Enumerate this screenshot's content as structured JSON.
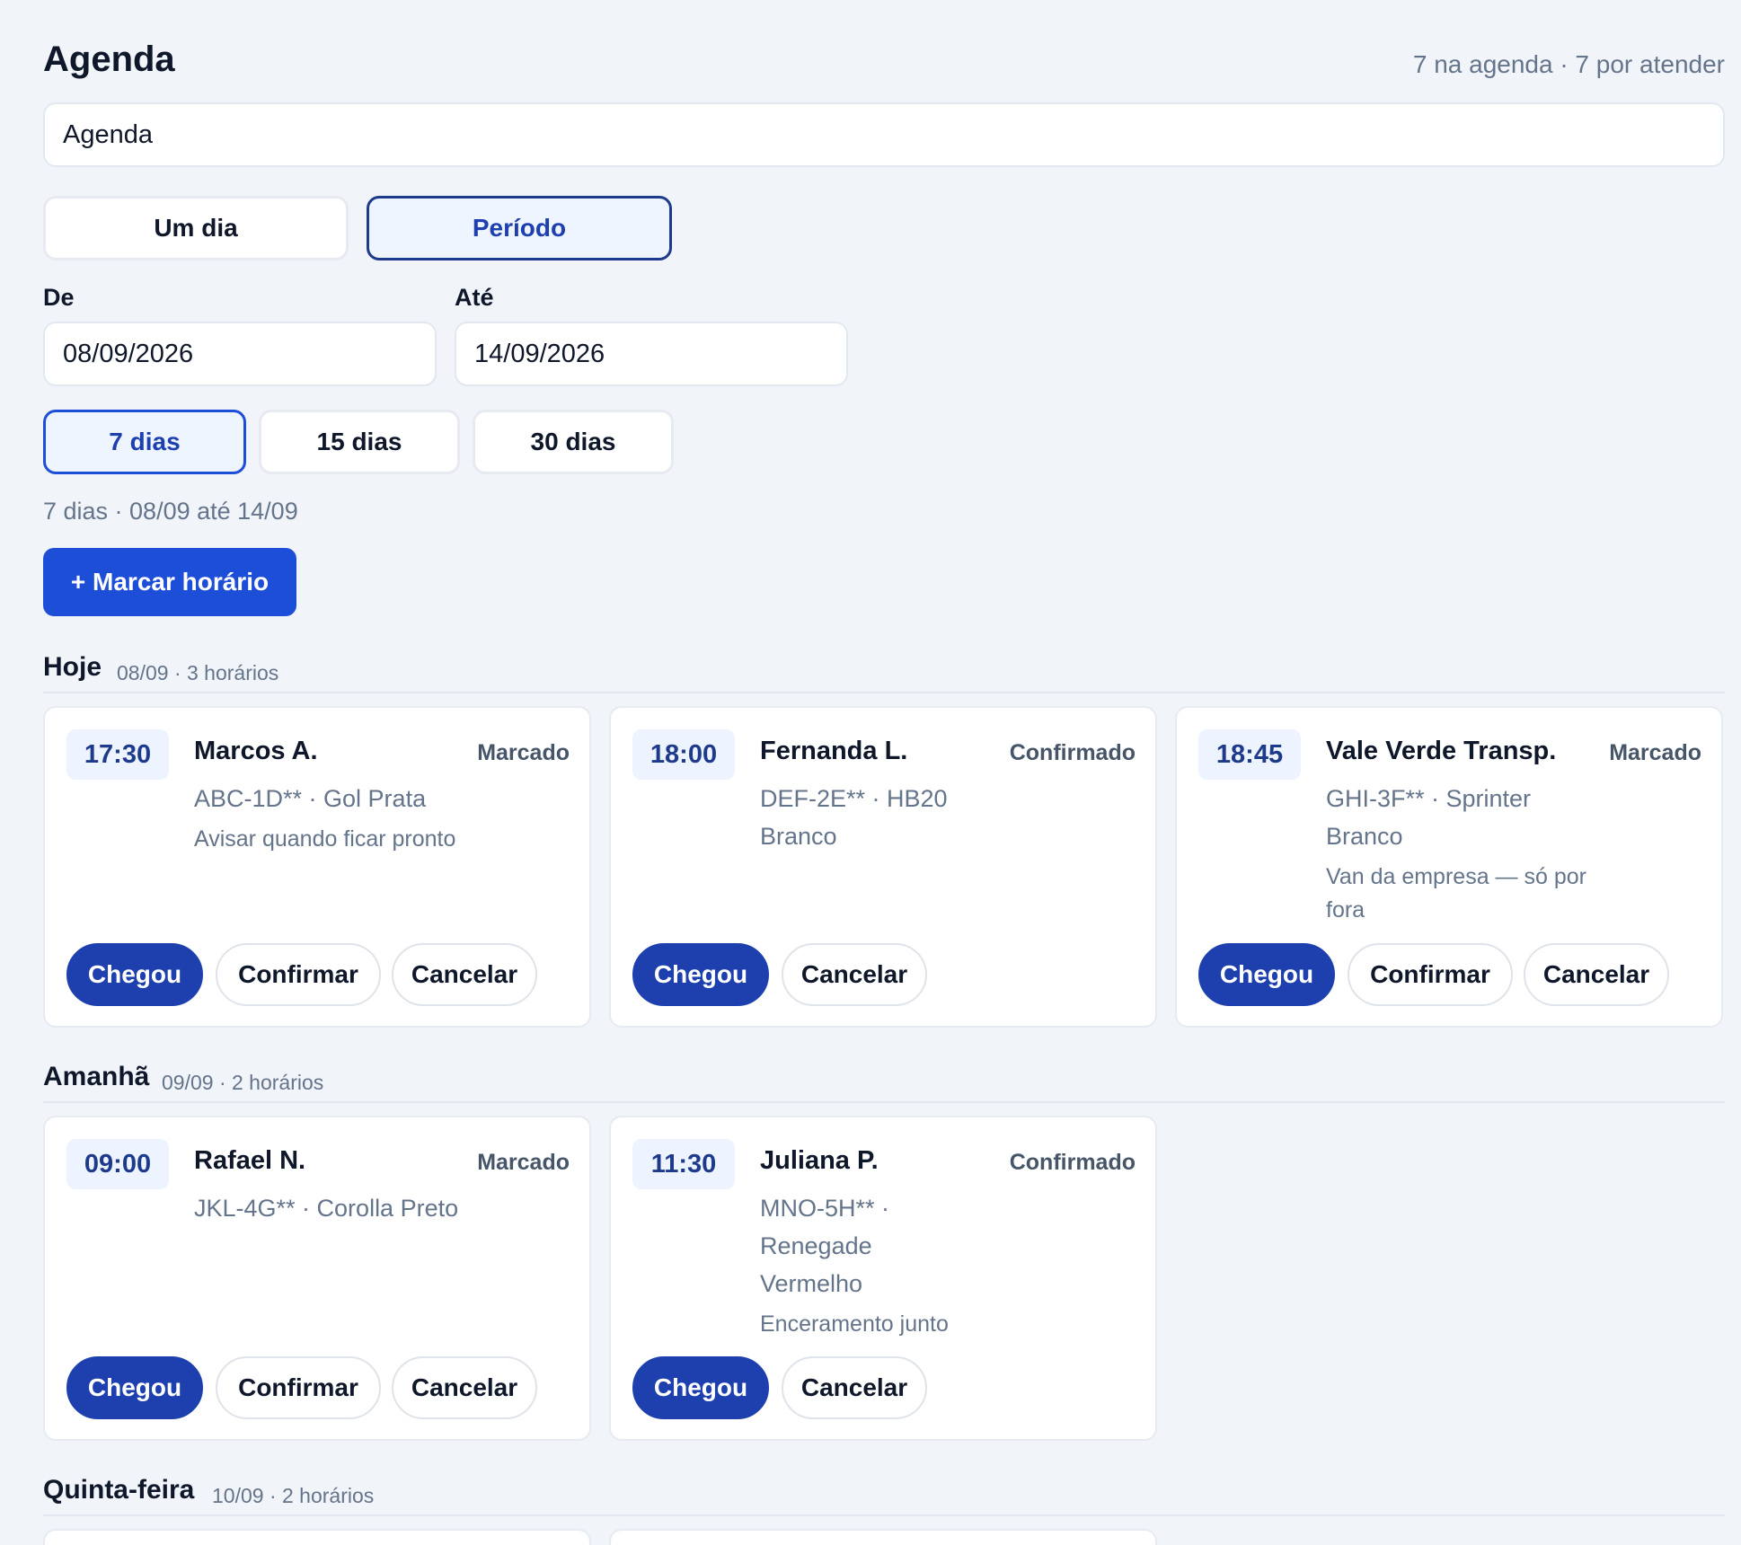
{
  "header": {
    "title": "Agenda",
    "summary": "7 na agenda · 7 por atender"
  },
  "search": {
    "value": "Agenda"
  },
  "mode": {
    "single": "Um dia",
    "period": "Período",
    "selected": "Período"
  },
  "filters": {
    "from_label": "De",
    "from_value": "08/09/2026",
    "to_label": "Até",
    "to_value": "14/09/2026"
  },
  "presets": {
    "items": [
      "7 dias",
      "15 dias",
      "30 dias"
    ],
    "selected": "7 dias"
  },
  "range_text": "7 dias · 08/09 até 14/09",
  "add_button": "+ Marcar horário",
  "groups": [
    {
      "day": "Hoje",
      "meta": "08/09 · 3 horários",
      "cards": [
        {
          "time": "17:30",
          "name": "Marcos A.",
          "status": "Marcado",
          "vehicle": "ABC-1D** · Gol Prata",
          "note": "Avisar quando ficar pronto",
          "actions": [
            "Chegou",
            "Confirmar",
            "Cancelar"
          ]
        },
        {
          "time": "18:00",
          "name": "Fernanda L.",
          "status": "Confirmado",
          "vehicle": "DEF-2E** · HB20 Branco",
          "note": "",
          "actions": [
            "Chegou",
            "Cancelar"
          ]
        },
        {
          "time": "18:45",
          "name": "Vale Verde Transp.",
          "status": "Marcado",
          "vehicle": "GHI-3F** · Sprinter Branco",
          "note": "Van da empresa — só por fora",
          "actions": [
            "Chegou",
            "Confirmar",
            "Cancelar"
          ]
        }
      ]
    },
    {
      "day": "Amanhã",
      "meta": "09/09 · 2 horários",
      "cards": [
        {
          "time": "09:00",
          "name": "Rafael N.",
          "status": "Marcado",
          "vehicle": "JKL-4G** · Corolla Preto",
          "note": "",
          "actions": [
            "Chegou",
            "Confirmar",
            "Cancelar"
          ]
        },
        {
          "time": "11:30",
          "name": "Juliana P.",
          "status": "Confirmado",
          "vehicle": "MNO-5H** · Renegade Vermelho",
          "note": "Enceramento junto",
          "actions": [
            "Chegou",
            "Cancelar"
          ]
        }
      ]
    },
    {
      "day": "Quinta-feira",
      "meta": "10/09 · 2 horários",
      "cards": []
    }
  ],
  "colors": {
    "accent": "#1d4ed8",
    "accent_dark": "#1e40af",
    "background": "#f1f4f9"
  }
}
